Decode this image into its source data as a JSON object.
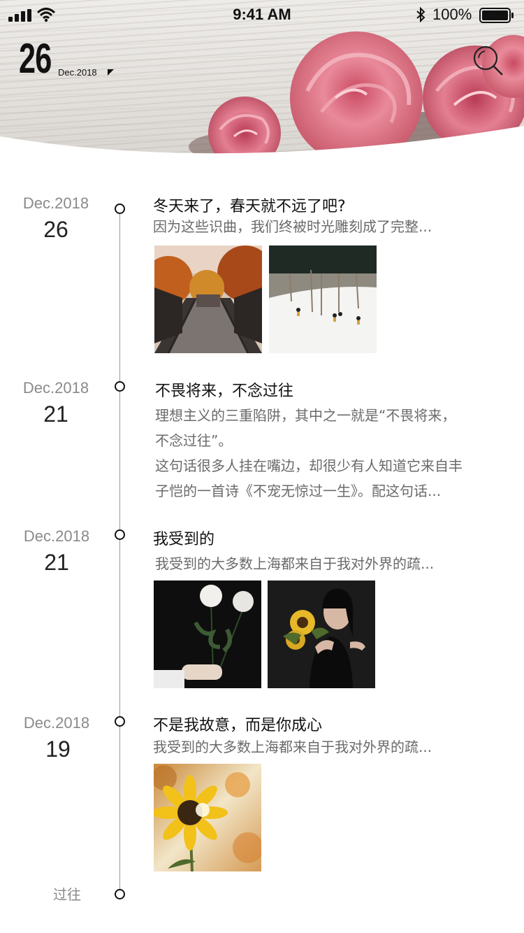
{
  "status_bar": {
    "time": "9:41 AM",
    "battery_percent": "100%",
    "signal_icon": "cellular-signal-icon",
    "wifi_icon": "wifi-icon",
    "bluetooth_icon": "bluetooth-icon",
    "battery_icon": "battery-icon"
  },
  "header": {
    "day": "26",
    "month_year": "Dec.2018",
    "dropdown_icon": "caret-down-icon",
    "search_icon": "search-icon"
  },
  "colors": {
    "accent_text": "#111111",
    "secondary_text": "#6a6a6a",
    "date_label": "#8a8a8a",
    "rose": "#e98a9a"
  },
  "entries": [
    {
      "month_year": "Dec.2018",
      "day": "26",
      "title": "冬天来了，春天就不远了吧?",
      "summary": "因为这些识曲，我们终被时光雕刻成了完整...",
      "photos": [
        "autumn-bridge-photo",
        "snowy-forest-photo"
      ]
    },
    {
      "month_year": "Dec.2018",
      "day": "21",
      "title": "不畏将来，不念过往",
      "summary_lines": [
        "理想主义的三重陷阱，其中之一就是“不畏将来，",
        "不念过往”。",
        "这句话很多人挂在嘴边，却很少有人知道它来自丰",
        "子恺的一首诗《不宠无惊过一生》。配这句话..."
      ],
      "photos": []
    },
    {
      "month_year": "Dec.2018",
      "day": "21",
      "title": "我受到的",
      "summary": "我受到的大多数上海都来自于我对外界的疏...",
      "photos": [
        "white-peonies-photo",
        "girl-with-sunflowers-photo"
      ]
    },
    {
      "month_year": "Dec.2018",
      "day": "19",
      "title": "不是我故意，而是你成心",
      "summary": "我受到的大多数上海都来自于我对外界的疏...",
      "photos": [
        "sunflower-photo"
      ]
    }
  ],
  "past_label": "过往"
}
